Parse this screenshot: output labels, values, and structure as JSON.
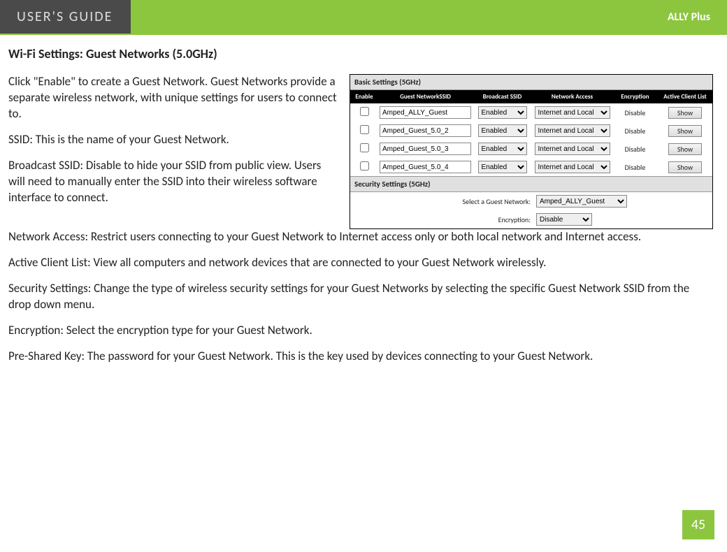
{
  "header": {
    "left": "USER'S GUIDE",
    "right": "ALLY Plus"
  },
  "page_title": "Wi-Fi Settings: Guest Networks (5.0GHz)",
  "paras_top": [
    "Click \"Enable\" to create a Guest Network. Guest Networks provide a separate wireless network, with unique settings for users to connect to.",
    "SSID: This is the name of your Guest Network.",
    "Broadcast SSID: Disable to hide your SSID from public view. Users will need to manually enter the SSID into their wireless software interface to connect."
  ],
  "paras_bottom": [
    "Network Access: Restrict users connecting to your Guest Network to Internet access only or both local network and Internet access.",
    "Active Client List: View all computers and network devices that are connected to your Guest Network wirelessly.",
    "Security Settings: Change the type of wireless security settings for your Guest Networks by selecting the specific Guest Network SSID from the drop down menu.",
    "Encryption: Select the encryption type for your Guest Network.",
    "Pre-Shared Key: The password for your Guest Network.  This is the key used by devices connecting to your Guest Network."
  ],
  "panel": {
    "basic_title": "Basic Settings (5GHz)",
    "header": {
      "enable": "Enable",
      "ssid": "Guest NetworkSSID",
      "broadcast": "Broadcast SSID",
      "access": "Network Access",
      "encryption": "Encryption",
      "active": "Active Client List"
    },
    "rows": [
      {
        "ssid": "Amped_ALLY_Guest",
        "broadcast": "Enabled",
        "access": "Internet and Local",
        "encryption": "Disable",
        "show": "Show"
      },
      {
        "ssid": "Amped_Guest_5.0_2",
        "broadcast": "Enabled",
        "access": "Internet and Local",
        "encryption": "Disable",
        "show": "Show"
      },
      {
        "ssid": "Amped_Guest_5.0_3",
        "broadcast": "Enabled",
        "access": "Internet and Local",
        "encryption": "Disable",
        "show": "Show"
      },
      {
        "ssid": "Amped_Guest_5.0_4",
        "broadcast": "Enabled",
        "access": "Internet and Local",
        "encryption": "Disable",
        "show": "Show"
      }
    ],
    "security_title": "Security Settings (5GHz)",
    "select_label": "Select a Guest Network:",
    "select_value": "Amped_ALLY_Guest",
    "enc_label": "Encryption:",
    "enc_value": "Disable"
  },
  "page_number": "45"
}
